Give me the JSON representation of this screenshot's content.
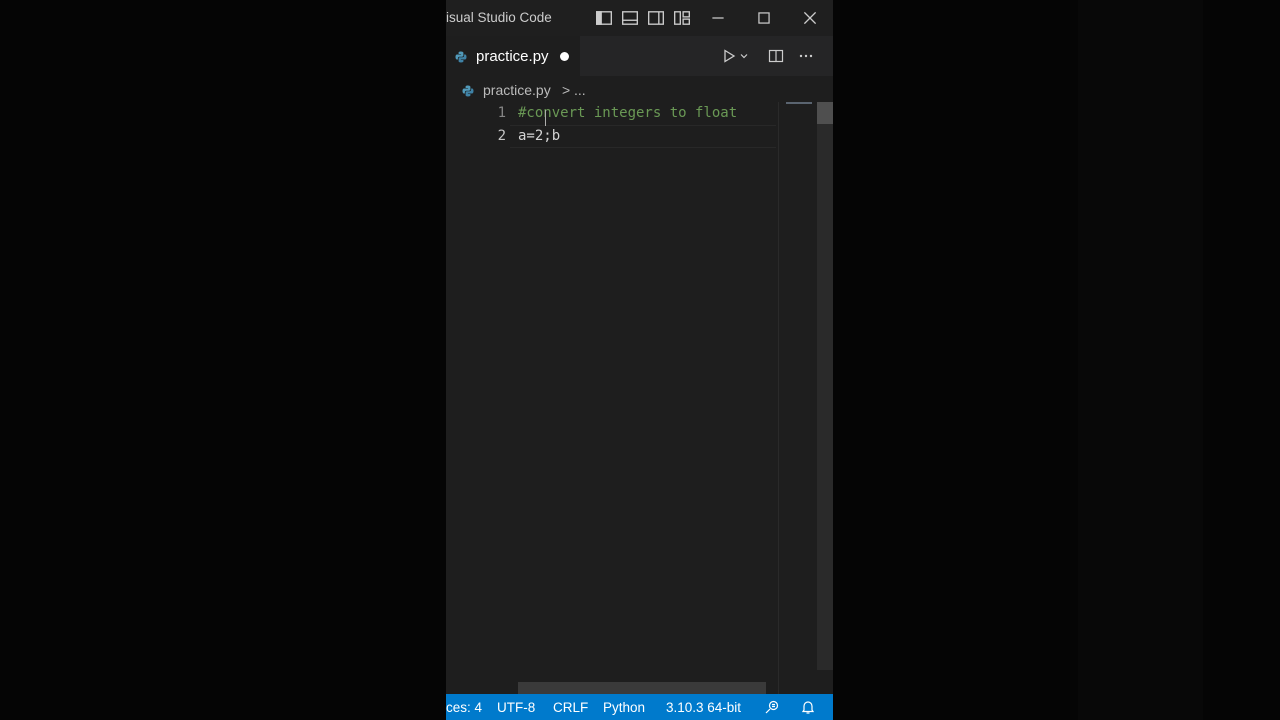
{
  "window": {
    "title": "isual Studio Code"
  },
  "tab": {
    "filename": "practice.py",
    "unsaved": true
  },
  "breadcrumb": {
    "file": "practice.py",
    "separator": ">",
    "more": "..."
  },
  "editor": {
    "lines": [
      {
        "number": "1",
        "text": "#convert integers to float",
        "kind": "comment"
      },
      {
        "number": "2",
        "text": "a=2;b",
        "kind": "plain"
      }
    ]
  },
  "statusbar": {
    "spaces": "ces: 4",
    "encoding": "UTF-8",
    "eol": "CRLF",
    "language": "Python",
    "interpreter": "3.10.3 64-bit"
  },
  "icons": {
    "file_type": "python-icon",
    "run": "play-icon",
    "split": "split-editor-icon",
    "more": "ellipsis-icon",
    "feedback": "feedback-icon",
    "notifications": "bell-icon"
  },
  "colors": {
    "accent": "#007acc",
    "comment": "#6a9955",
    "editor_bg": "#1e1e1e"
  }
}
